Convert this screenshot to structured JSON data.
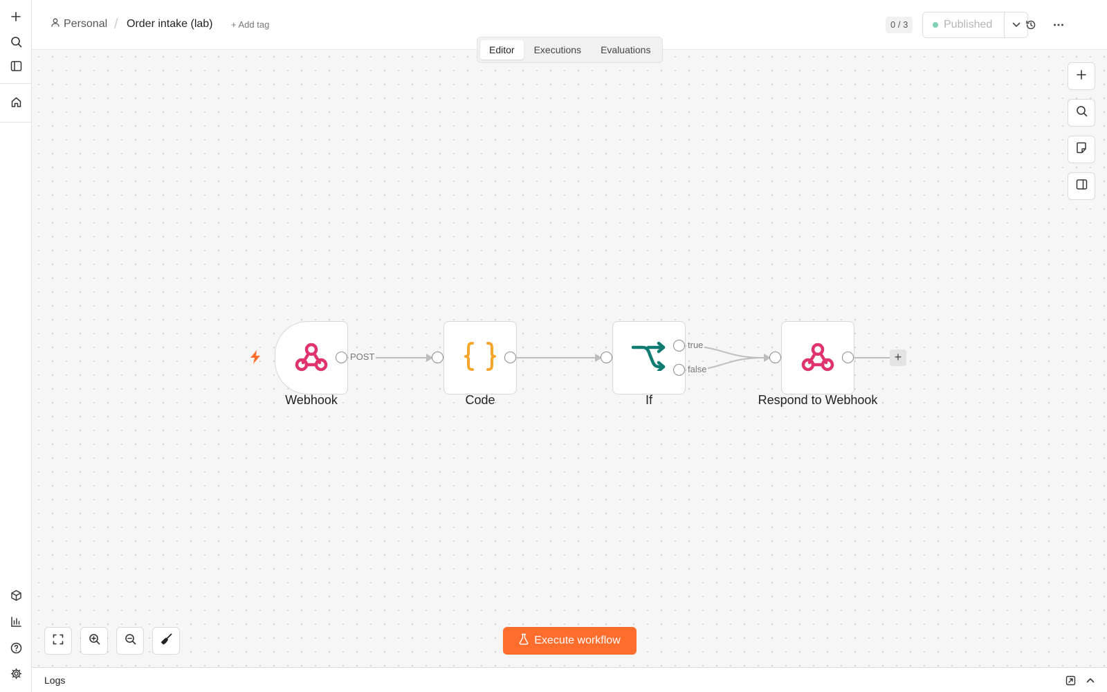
{
  "header": {
    "project": "Personal",
    "separator": "/",
    "workflow_name": "Order intake (lab)",
    "add_tag": "+ Add tag",
    "counter": "0 / 3",
    "publish_label": "Published"
  },
  "tabs": [
    {
      "label": "Editor",
      "active": true
    },
    {
      "label": "Executions",
      "active": false
    },
    {
      "label": "Evaluations",
      "active": false
    }
  ],
  "nodes": [
    {
      "label": "Webhook",
      "icon": "webhook-icon",
      "color": "#e0336b"
    },
    {
      "label": "Code",
      "icon": "code-braces-icon",
      "color": "#f5a52a"
    },
    {
      "label": "If",
      "icon": "if-branch-icon",
      "color": "#0f7b72"
    },
    {
      "label": "Respond to Webhook",
      "icon": "webhook-icon",
      "color": "#e0336b"
    }
  ],
  "edge_labels": {
    "webhook_out": "POST",
    "if_true": "true",
    "if_false": "false"
  },
  "execute_button": "Execute workflow",
  "logs": {
    "title": "Logs"
  },
  "colors": {
    "accent": "#ff6d2d",
    "published_dot": "#7fd1b9"
  }
}
